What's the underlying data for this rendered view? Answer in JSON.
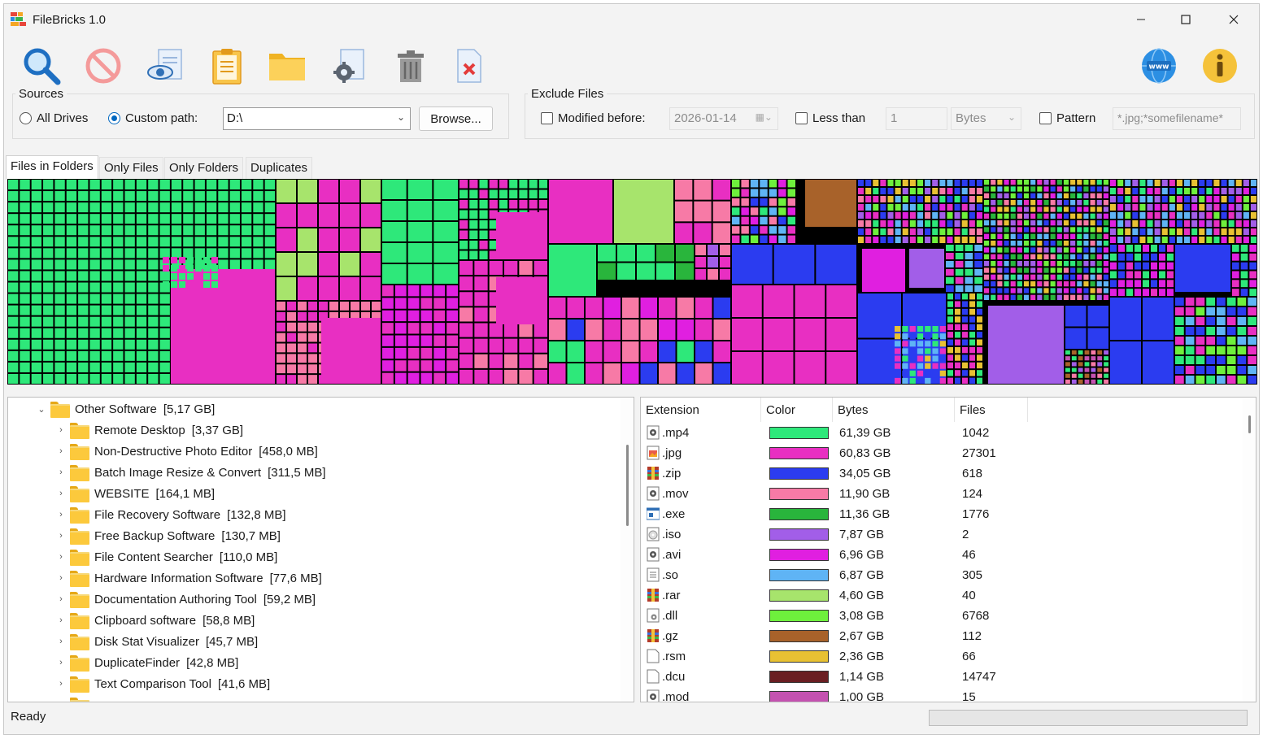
{
  "window": {
    "title": "FileBricks 1.0",
    "buttons": [
      "minimize",
      "maximize",
      "close"
    ]
  },
  "toolbar": {
    "left": [
      {
        "name": "scan-button",
        "icon": "magnifier-icon"
      },
      {
        "name": "stop-button",
        "icon": "stop-icon"
      },
      {
        "name": "preview-button",
        "icon": "eye-document-icon"
      },
      {
        "name": "copy-button",
        "icon": "clipboard-icon"
      },
      {
        "name": "open-folder-button",
        "icon": "folder-icon"
      },
      {
        "name": "settings-button",
        "icon": "gear-document-icon"
      },
      {
        "name": "delete-button",
        "icon": "trash-icon"
      },
      {
        "name": "remove-file-button",
        "icon": "x-document-icon"
      }
    ],
    "right": [
      {
        "name": "website-button",
        "icon": "globe-www-icon"
      },
      {
        "name": "about-button",
        "icon": "info-icon"
      }
    ]
  },
  "sources": {
    "label": "Sources",
    "all_drives": "All Drives",
    "custom_path": "Custom path:",
    "selected": "custom",
    "path_value": "D:\\",
    "browse": "Browse..."
  },
  "exclude": {
    "label": "Exclude Files",
    "modified_before": "Modified before:",
    "date_value": "2026-01-14",
    "less_than": "Less than",
    "size_value": "1",
    "unit": "Bytes",
    "pattern": "Pattern",
    "pattern_placeholder": "*.jpg;*somefilename*"
  },
  "tabs": [
    "Files in Folders",
    "Only Files",
    "Only Folders",
    "Duplicates"
  ],
  "active_tab": 0,
  "tree": {
    "root": {
      "label": "Other Software",
      "size": "[5,17 GB]"
    },
    "children": [
      {
        "label": "Remote Desktop",
        "size": "[3,37 GB]"
      },
      {
        "label": "Non-Destructive Photo Editor",
        "size": "[458,0 MB]"
      },
      {
        "label": "Batch Image Resize & Convert",
        "size": "[311,5 MB]"
      },
      {
        "label": "WEBSITE",
        "size": "[164,1 MB]"
      },
      {
        "label": "File Recovery Software",
        "size": "[132,8 MB]"
      },
      {
        "label": "Free Backup Software",
        "size": "[130,7 MB]"
      },
      {
        "label": "File Content Searcher",
        "size": "[110,0 MB]"
      },
      {
        "label": "Hardware Information Software",
        "size": "[77,6 MB]"
      },
      {
        "label": "Documentation Authoring Tool",
        "size": "[59,2 MB]"
      },
      {
        "label": "Clipboard software",
        "size": "[58,8 MB]"
      },
      {
        "label": "Disk Stat Visualizer",
        "size": "[45,7 MB]"
      },
      {
        "label": "DuplicateFinder",
        "size": "[42,8 MB]"
      },
      {
        "label": "Text Comparison Tool",
        "size": "[41,6 MB]"
      }
    ]
  },
  "extensions": {
    "headers": [
      "Extension",
      "Color",
      "Bytes",
      "Files"
    ],
    "rows": [
      {
        "ext": ".mp4",
        "color": "#2ee87a",
        "bytes": "61,39 GB",
        "files": "1042",
        "icon": "video-file-icon"
      },
      {
        "ext": ".jpg",
        "color": "#e82fc2",
        "bytes": "60,83 GB",
        "files": "27301",
        "icon": "image-file-icon"
      },
      {
        "ext": ".zip",
        "color": "#2b3cf0",
        "bytes": "34,05 GB",
        "files": "618",
        "icon": "archive-file-icon"
      },
      {
        "ext": ".mov",
        "color": "#f77aa6",
        "bytes": "11,90 GB",
        "files": "124",
        "icon": "video-file-icon"
      },
      {
        "ext": ".exe",
        "color": "#29b53c",
        "bytes": "11,36 GB",
        "files": "1776",
        "icon": "exe-file-icon"
      },
      {
        "ext": ".iso",
        "color": "#a25ee8",
        "bytes": "7,87 GB",
        "files": "2",
        "icon": "disc-file-icon"
      },
      {
        "ext": ".avi",
        "color": "#e01fe0",
        "bytes": "6,96 GB",
        "files": "46",
        "icon": "video-file-icon"
      },
      {
        "ext": ".so",
        "color": "#5fb4f5",
        "bytes": "6,87 GB",
        "files": "305",
        "icon": "text-file-icon"
      },
      {
        "ext": ".rar",
        "color": "#a7e46c",
        "bytes": "4,60 GB",
        "files": "40",
        "icon": "archive-file-icon"
      },
      {
        "ext": ".dll",
        "color": "#6ef03c",
        "bytes": "3,08 GB",
        "files": "6768",
        "icon": "dll-file-icon"
      },
      {
        "ext": ".gz",
        "color": "#a8622a",
        "bytes": "2,67 GB",
        "files": "112",
        "icon": "archive-file-icon"
      },
      {
        "ext": ".rsm",
        "color": "#e8c133",
        "bytes": "2,36 GB",
        "files": "66",
        "icon": "blank-file-icon"
      },
      {
        "ext": ".dcu",
        "color": "#6a1e22",
        "bytes": "1,14 GB",
        "files": "14747",
        "icon": "blank-file-icon"
      },
      {
        "ext": ".mod",
        "color": "#c452b0",
        "bytes": "1,00 GB",
        "files": "15",
        "icon": "video-file-icon"
      }
    ]
  },
  "status": {
    "text": "Ready",
    "progress": 0
  }
}
